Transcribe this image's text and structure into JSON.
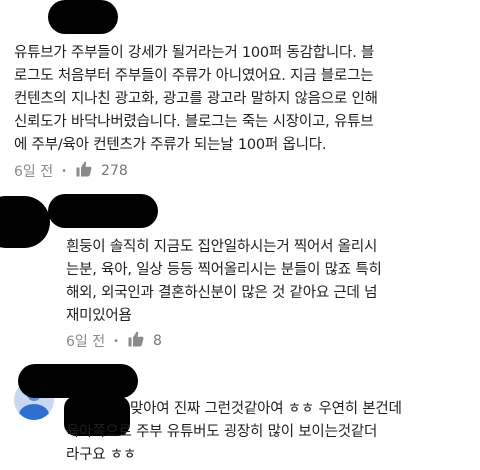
{
  "comments": [
    {
      "text": "유튜브가 주부들이 강세가 될거라는거 100퍼 동감합니다. 블\n로그도 처음부터 주부들이 주류가 아니였어요. 지금 블로그는\n컨텐츠의 지나친 광고화, 광고를 광고라 말하지 않음으로 인해\n신뢰도가 바닥나버렸습니다. 블로그는 죽는 시장이고, 유튜브\n에 주부/육아 컨텐츠가 주류가 되는날 100퍼 옵니다.",
      "time": "6일 전",
      "separator": "•",
      "likes": "278"
    },
    {
      "text": "흰둥이 솔직히 지금도 집안일하시는거 찍어서 올리시\n는분, 육아, 일상 등등 찍어올리시는 분들이 많죠 특히\n해외, 외국인과 결혼하신분이 많은 것 같아요  근데 넘\n재미있어욤",
      "time": "6일 전",
      "separator": "•",
      "likes": "8"
    },
    {
      "text": "맞아여 진짜 그런것같아여 ㅎㅎ 우연히 본건데\n육아쪽으로 주부 유튜버도 굉장히 많이 보이는것같더\n라구요 ㅎㅎ"
    }
  ],
  "colors": {
    "meta": "#8a8a8a",
    "avatar_bg": "#c8d8f0",
    "avatar_fg": "#2f6fd0"
  }
}
